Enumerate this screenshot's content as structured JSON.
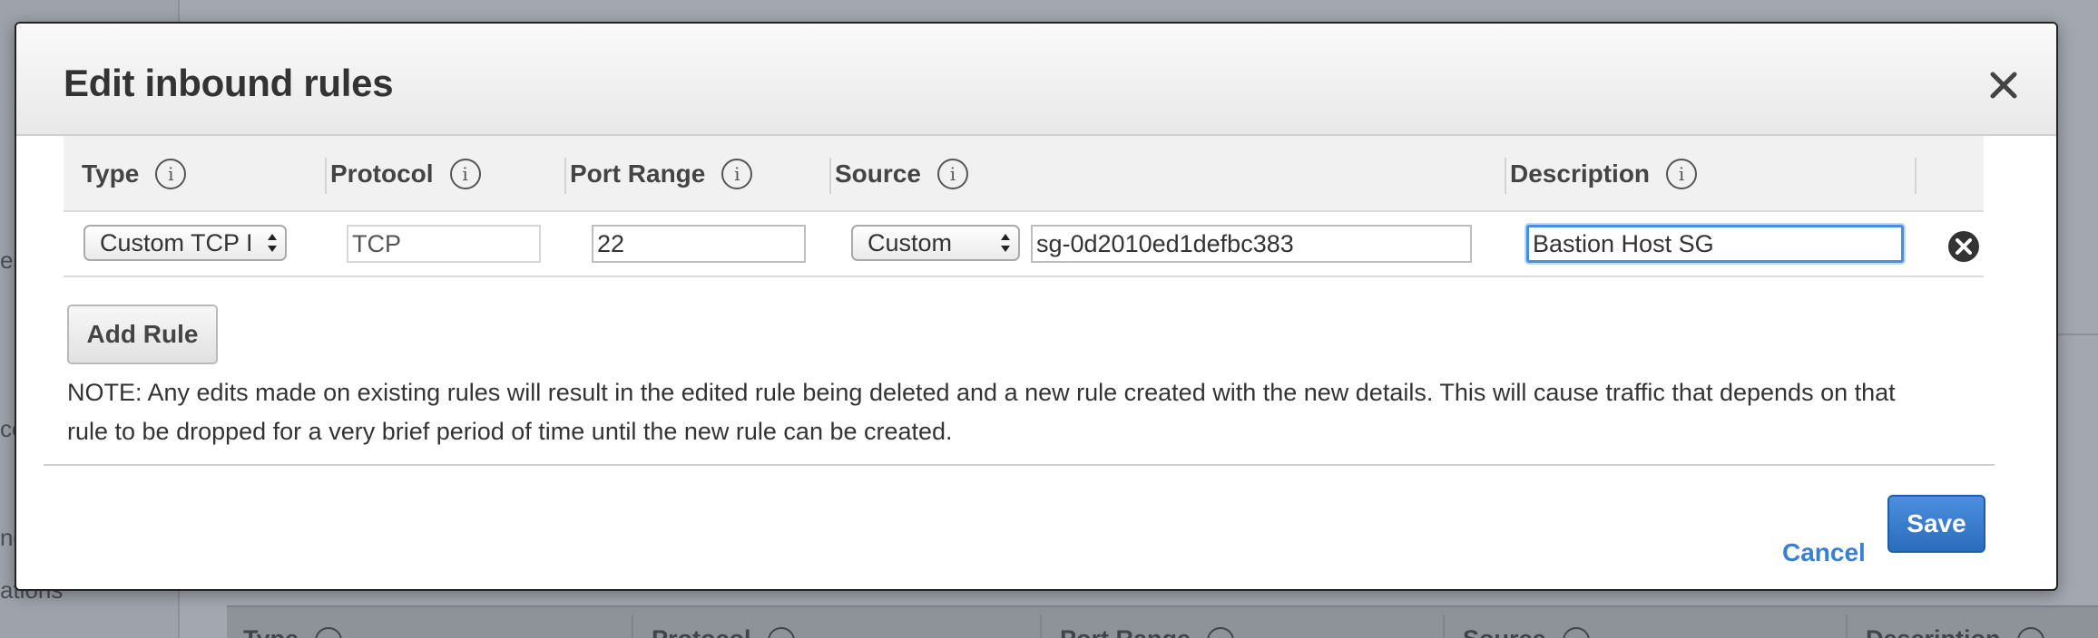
{
  "background": {
    "sidebar_fragments": [
      "es",
      "ce",
      "nd",
      "ations"
    ],
    "table_columns": [
      "Type",
      "Protocol",
      "Port Range",
      "Source",
      "Description"
    ]
  },
  "modal": {
    "title": "Edit inbound rules",
    "columns": {
      "type": "Type",
      "protocol": "Protocol",
      "port_range": "Port Range",
      "source": "Source",
      "description": "Description"
    },
    "rules": [
      {
        "type": "Custom TCP I",
        "protocol": "TCP",
        "port_range": "22",
        "source_type": "Custom",
        "source_value": "sg-0d2010ed1defbc383",
        "description": "Bastion Host SG"
      }
    ],
    "add_rule_label": "Add Rule",
    "note": "NOTE: Any edits made on existing rules will result in the edited rule being deleted and a new rule created with the new details. This will cause traffic that depends on that rule to be dropped for a very brief period of time until the new rule can be created.",
    "cancel_label": "Cancel",
    "save_label": "Save"
  },
  "colors": {
    "primary": "#2b6cbc",
    "link": "#3a80d2",
    "focus": "#4a8de0"
  }
}
